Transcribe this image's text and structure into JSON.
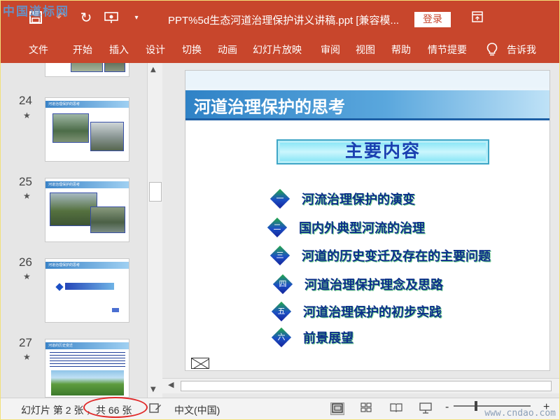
{
  "watermark": {
    "top": "中国道标网",
    "bottom": "www.cndao.com"
  },
  "titlebar": {
    "quick_access": [
      "save-icon",
      "undo-icon",
      "redo-icon",
      "slideshow-icon",
      "dropdown-icon"
    ],
    "document_title": "PPT%5d生态河道治理保护讲义讲稿.ppt [兼容模...",
    "login_label": "登录",
    "window_icon": "ribbon-display-icon"
  },
  "ribbon": {
    "tabs": [
      "文件",
      "开始",
      "插入",
      "设计",
      "切换",
      "动画",
      "幻灯片放映",
      "审阅",
      "视图",
      "帮助",
      "情节提要",
      "告诉我"
    ],
    "tell_me_icon": "lightbulb-icon"
  },
  "thumbnails": [
    {
      "number": "24",
      "title": "河道治理保护的思考"
    },
    {
      "number": "25",
      "title": "河道治理保护的思考"
    },
    {
      "number": "26",
      "title": "河道治理保护的思考"
    },
    {
      "number": "27",
      "title": "河道的历史变迁"
    }
  ],
  "slide": {
    "title": "河道治理保护的思考",
    "main_heading": "主要内容",
    "items": [
      {
        "num": "一",
        "text": "河流治理保护的演变"
      },
      {
        "num": "二",
        "text": "国内外典型河流的治理"
      },
      {
        "num": "三",
        "text": "河道的历史变迁及存在的主要问题"
      },
      {
        "num": "四",
        "text": "河道治理保护理念及思路"
      },
      {
        "num": "五",
        "text": "河道治理保护的初步实践"
      },
      {
        "num": "六",
        "text": "前景展望"
      }
    ]
  },
  "status": {
    "slide_info": "幻灯片 第 2 张",
    "slide_total": "，共 66 张",
    "language": "中文(中国)",
    "view_icons": [
      "normal-view-icon",
      "slide-sorter-icon",
      "reading-view-icon",
      "slideshow-view-icon"
    ],
    "zoom_minus": "-",
    "zoom_plus": "+"
  },
  "colors": {
    "accent": "#c8462c",
    "title_blue": "#2f82c6",
    "item_text": "#0d2f8a"
  }
}
